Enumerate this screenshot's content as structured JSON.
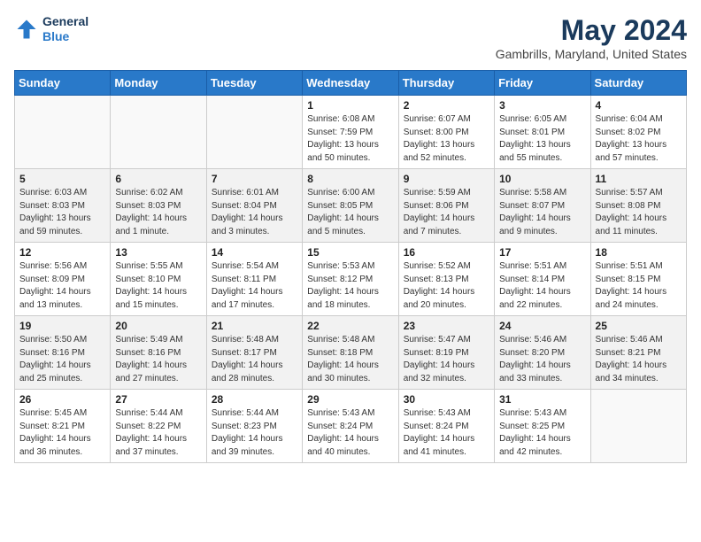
{
  "header": {
    "logo_line1": "General",
    "logo_line2": "Blue",
    "title": "May 2024",
    "subtitle": "Gambrills, Maryland, United States"
  },
  "weekdays": [
    "Sunday",
    "Monday",
    "Tuesday",
    "Wednesday",
    "Thursday",
    "Friday",
    "Saturday"
  ],
  "weeks": [
    [
      {
        "day": "",
        "sunrise": "",
        "sunset": "",
        "daylight": ""
      },
      {
        "day": "",
        "sunrise": "",
        "sunset": "",
        "daylight": ""
      },
      {
        "day": "",
        "sunrise": "",
        "sunset": "",
        "daylight": ""
      },
      {
        "day": "1",
        "sunrise": "Sunrise: 6:08 AM",
        "sunset": "Sunset: 7:59 PM",
        "daylight": "Daylight: 13 hours and 50 minutes."
      },
      {
        "day": "2",
        "sunrise": "Sunrise: 6:07 AM",
        "sunset": "Sunset: 8:00 PM",
        "daylight": "Daylight: 13 hours and 52 minutes."
      },
      {
        "day": "3",
        "sunrise": "Sunrise: 6:05 AM",
        "sunset": "Sunset: 8:01 PM",
        "daylight": "Daylight: 13 hours and 55 minutes."
      },
      {
        "day": "4",
        "sunrise": "Sunrise: 6:04 AM",
        "sunset": "Sunset: 8:02 PM",
        "daylight": "Daylight: 13 hours and 57 minutes."
      }
    ],
    [
      {
        "day": "5",
        "sunrise": "Sunrise: 6:03 AM",
        "sunset": "Sunset: 8:03 PM",
        "daylight": "Daylight: 13 hours and 59 minutes."
      },
      {
        "day": "6",
        "sunrise": "Sunrise: 6:02 AM",
        "sunset": "Sunset: 8:03 PM",
        "daylight": "Daylight: 14 hours and 1 minute."
      },
      {
        "day": "7",
        "sunrise": "Sunrise: 6:01 AM",
        "sunset": "Sunset: 8:04 PM",
        "daylight": "Daylight: 14 hours and 3 minutes."
      },
      {
        "day": "8",
        "sunrise": "Sunrise: 6:00 AM",
        "sunset": "Sunset: 8:05 PM",
        "daylight": "Daylight: 14 hours and 5 minutes."
      },
      {
        "day": "9",
        "sunrise": "Sunrise: 5:59 AM",
        "sunset": "Sunset: 8:06 PM",
        "daylight": "Daylight: 14 hours and 7 minutes."
      },
      {
        "day": "10",
        "sunrise": "Sunrise: 5:58 AM",
        "sunset": "Sunset: 8:07 PM",
        "daylight": "Daylight: 14 hours and 9 minutes."
      },
      {
        "day": "11",
        "sunrise": "Sunrise: 5:57 AM",
        "sunset": "Sunset: 8:08 PM",
        "daylight": "Daylight: 14 hours and 11 minutes."
      }
    ],
    [
      {
        "day": "12",
        "sunrise": "Sunrise: 5:56 AM",
        "sunset": "Sunset: 8:09 PM",
        "daylight": "Daylight: 14 hours and 13 minutes."
      },
      {
        "day": "13",
        "sunrise": "Sunrise: 5:55 AM",
        "sunset": "Sunset: 8:10 PM",
        "daylight": "Daylight: 14 hours and 15 minutes."
      },
      {
        "day": "14",
        "sunrise": "Sunrise: 5:54 AM",
        "sunset": "Sunset: 8:11 PM",
        "daylight": "Daylight: 14 hours and 17 minutes."
      },
      {
        "day": "15",
        "sunrise": "Sunrise: 5:53 AM",
        "sunset": "Sunset: 8:12 PM",
        "daylight": "Daylight: 14 hours and 18 minutes."
      },
      {
        "day": "16",
        "sunrise": "Sunrise: 5:52 AM",
        "sunset": "Sunset: 8:13 PM",
        "daylight": "Daylight: 14 hours and 20 minutes."
      },
      {
        "day": "17",
        "sunrise": "Sunrise: 5:51 AM",
        "sunset": "Sunset: 8:14 PM",
        "daylight": "Daylight: 14 hours and 22 minutes."
      },
      {
        "day": "18",
        "sunrise": "Sunrise: 5:51 AM",
        "sunset": "Sunset: 8:15 PM",
        "daylight": "Daylight: 14 hours and 24 minutes."
      }
    ],
    [
      {
        "day": "19",
        "sunrise": "Sunrise: 5:50 AM",
        "sunset": "Sunset: 8:16 PM",
        "daylight": "Daylight: 14 hours and 25 minutes."
      },
      {
        "day": "20",
        "sunrise": "Sunrise: 5:49 AM",
        "sunset": "Sunset: 8:16 PM",
        "daylight": "Daylight: 14 hours and 27 minutes."
      },
      {
        "day": "21",
        "sunrise": "Sunrise: 5:48 AM",
        "sunset": "Sunset: 8:17 PM",
        "daylight": "Daylight: 14 hours and 28 minutes."
      },
      {
        "day": "22",
        "sunrise": "Sunrise: 5:48 AM",
        "sunset": "Sunset: 8:18 PM",
        "daylight": "Daylight: 14 hours and 30 minutes."
      },
      {
        "day": "23",
        "sunrise": "Sunrise: 5:47 AM",
        "sunset": "Sunset: 8:19 PM",
        "daylight": "Daylight: 14 hours and 32 minutes."
      },
      {
        "day": "24",
        "sunrise": "Sunrise: 5:46 AM",
        "sunset": "Sunset: 8:20 PM",
        "daylight": "Daylight: 14 hours and 33 minutes."
      },
      {
        "day": "25",
        "sunrise": "Sunrise: 5:46 AM",
        "sunset": "Sunset: 8:21 PM",
        "daylight": "Daylight: 14 hours and 34 minutes."
      }
    ],
    [
      {
        "day": "26",
        "sunrise": "Sunrise: 5:45 AM",
        "sunset": "Sunset: 8:21 PM",
        "daylight": "Daylight: 14 hours and 36 minutes."
      },
      {
        "day": "27",
        "sunrise": "Sunrise: 5:44 AM",
        "sunset": "Sunset: 8:22 PM",
        "daylight": "Daylight: 14 hours and 37 minutes."
      },
      {
        "day": "28",
        "sunrise": "Sunrise: 5:44 AM",
        "sunset": "Sunset: 8:23 PM",
        "daylight": "Daylight: 14 hours and 39 minutes."
      },
      {
        "day": "29",
        "sunrise": "Sunrise: 5:43 AM",
        "sunset": "Sunset: 8:24 PM",
        "daylight": "Daylight: 14 hours and 40 minutes."
      },
      {
        "day": "30",
        "sunrise": "Sunrise: 5:43 AM",
        "sunset": "Sunset: 8:24 PM",
        "daylight": "Daylight: 14 hours and 41 minutes."
      },
      {
        "day": "31",
        "sunrise": "Sunrise: 5:43 AM",
        "sunset": "Sunset: 8:25 PM",
        "daylight": "Daylight: 14 hours and 42 minutes."
      },
      {
        "day": "",
        "sunrise": "",
        "sunset": "",
        "daylight": ""
      }
    ]
  ]
}
